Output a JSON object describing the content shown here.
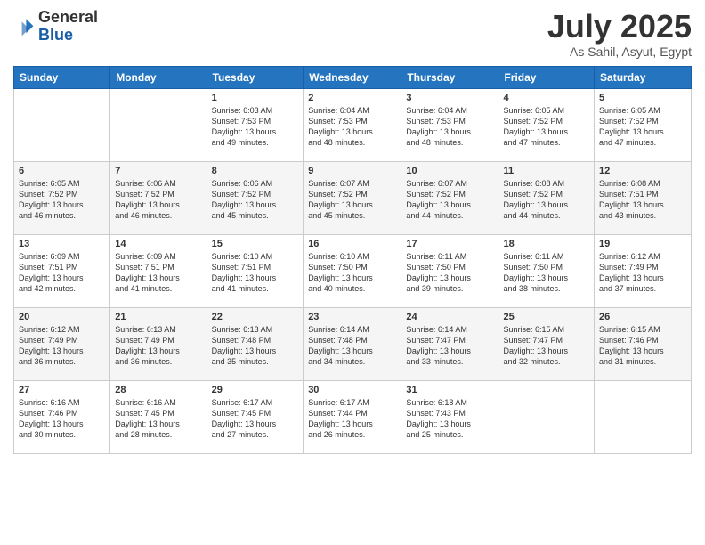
{
  "header": {
    "logo": {
      "general": "General",
      "blue": "Blue"
    },
    "title": "July 2025",
    "subtitle": "As Sahil, Asyut, Egypt"
  },
  "days_of_week": [
    "Sunday",
    "Monday",
    "Tuesday",
    "Wednesday",
    "Thursday",
    "Friday",
    "Saturday"
  ],
  "weeks": [
    [
      {
        "day": "",
        "info": ""
      },
      {
        "day": "",
        "info": ""
      },
      {
        "day": "1",
        "info": "Sunrise: 6:03 AM\nSunset: 7:53 PM\nDaylight: 13 hours\nand 49 minutes."
      },
      {
        "day": "2",
        "info": "Sunrise: 6:04 AM\nSunset: 7:53 PM\nDaylight: 13 hours\nand 48 minutes."
      },
      {
        "day": "3",
        "info": "Sunrise: 6:04 AM\nSunset: 7:53 PM\nDaylight: 13 hours\nand 48 minutes."
      },
      {
        "day": "4",
        "info": "Sunrise: 6:05 AM\nSunset: 7:52 PM\nDaylight: 13 hours\nand 47 minutes."
      },
      {
        "day": "5",
        "info": "Sunrise: 6:05 AM\nSunset: 7:52 PM\nDaylight: 13 hours\nand 47 minutes."
      }
    ],
    [
      {
        "day": "6",
        "info": "Sunrise: 6:05 AM\nSunset: 7:52 PM\nDaylight: 13 hours\nand 46 minutes."
      },
      {
        "day": "7",
        "info": "Sunrise: 6:06 AM\nSunset: 7:52 PM\nDaylight: 13 hours\nand 46 minutes."
      },
      {
        "day": "8",
        "info": "Sunrise: 6:06 AM\nSunset: 7:52 PM\nDaylight: 13 hours\nand 45 minutes."
      },
      {
        "day": "9",
        "info": "Sunrise: 6:07 AM\nSunset: 7:52 PM\nDaylight: 13 hours\nand 45 minutes."
      },
      {
        "day": "10",
        "info": "Sunrise: 6:07 AM\nSunset: 7:52 PM\nDaylight: 13 hours\nand 44 minutes."
      },
      {
        "day": "11",
        "info": "Sunrise: 6:08 AM\nSunset: 7:52 PM\nDaylight: 13 hours\nand 44 minutes."
      },
      {
        "day": "12",
        "info": "Sunrise: 6:08 AM\nSunset: 7:51 PM\nDaylight: 13 hours\nand 43 minutes."
      }
    ],
    [
      {
        "day": "13",
        "info": "Sunrise: 6:09 AM\nSunset: 7:51 PM\nDaylight: 13 hours\nand 42 minutes."
      },
      {
        "day": "14",
        "info": "Sunrise: 6:09 AM\nSunset: 7:51 PM\nDaylight: 13 hours\nand 41 minutes."
      },
      {
        "day": "15",
        "info": "Sunrise: 6:10 AM\nSunset: 7:51 PM\nDaylight: 13 hours\nand 41 minutes."
      },
      {
        "day": "16",
        "info": "Sunrise: 6:10 AM\nSunset: 7:50 PM\nDaylight: 13 hours\nand 40 minutes."
      },
      {
        "day": "17",
        "info": "Sunrise: 6:11 AM\nSunset: 7:50 PM\nDaylight: 13 hours\nand 39 minutes."
      },
      {
        "day": "18",
        "info": "Sunrise: 6:11 AM\nSunset: 7:50 PM\nDaylight: 13 hours\nand 38 minutes."
      },
      {
        "day": "19",
        "info": "Sunrise: 6:12 AM\nSunset: 7:49 PM\nDaylight: 13 hours\nand 37 minutes."
      }
    ],
    [
      {
        "day": "20",
        "info": "Sunrise: 6:12 AM\nSunset: 7:49 PM\nDaylight: 13 hours\nand 36 minutes."
      },
      {
        "day": "21",
        "info": "Sunrise: 6:13 AM\nSunset: 7:49 PM\nDaylight: 13 hours\nand 36 minutes."
      },
      {
        "day": "22",
        "info": "Sunrise: 6:13 AM\nSunset: 7:48 PM\nDaylight: 13 hours\nand 35 minutes."
      },
      {
        "day": "23",
        "info": "Sunrise: 6:14 AM\nSunset: 7:48 PM\nDaylight: 13 hours\nand 34 minutes."
      },
      {
        "day": "24",
        "info": "Sunrise: 6:14 AM\nSunset: 7:47 PM\nDaylight: 13 hours\nand 33 minutes."
      },
      {
        "day": "25",
        "info": "Sunrise: 6:15 AM\nSunset: 7:47 PM\nDaylight: 13 hours\nand 32 minutes."
      },
      {
        "day": "26",
        "info": "Sunrise: 6:15 AM\nSunset: 7:46 PM\nDaylight: 13 hours\nand 31 minutes."
      }
    ],
    [
      {
        "day": "27",
        "info": "Sunrise: 6:16 AM\nSunset: 7:46 PM\nDaylight: 13 hours\nand 30 minutes."
      },
      {
        "day": "28",
        "info": "Sunrise: 6:16 AM\nSunset: 7:45 PM\nDaylight: 13 hours\nand 28 minutes."
      },
      {
        "day": "29",
        "info": "Sunrise: 6:17 AM\nSunset: 7:45 PM\nDaylight: 13 hours\nand 27 minutes."
      },
      {
        "day": "30",
        "info": "Sunrise: 6:17 AM\nSunset: 7:44 PM\nDaylight: 13 hours\nand 26 minutes."
      },
      {
        "day": "31",
        "info": "Sunrise: 6:18 AM\nSunset: 7:43 PM\nDaylight: 13 hours\nand 25 minutes."
      },
      {
        "day": "",
        "info": ""
      },
      {
        "day": "",
        "info": ""
      }
    ]
  ]
}
